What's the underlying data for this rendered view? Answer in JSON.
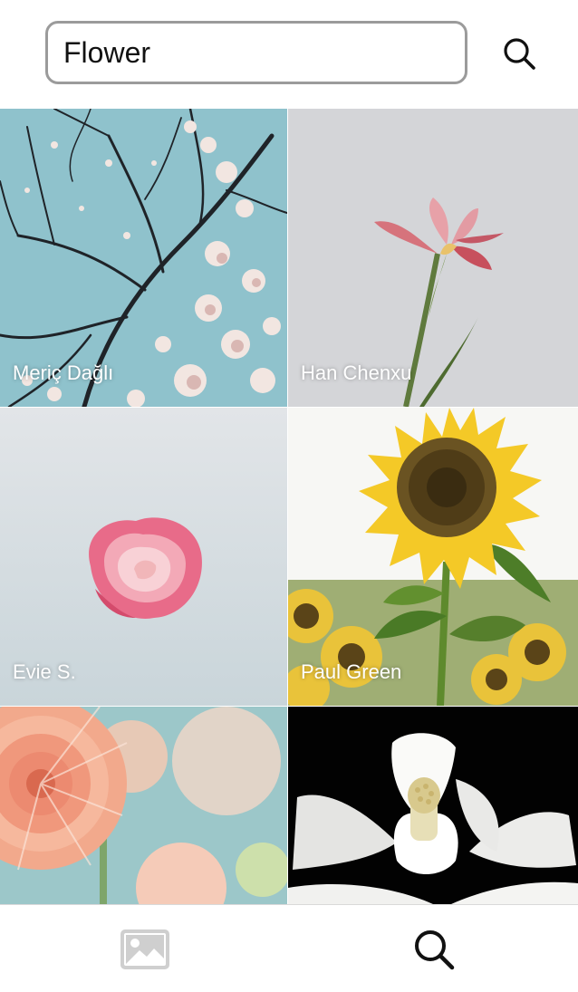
{
  "search": {
    "query": "Flower",
    "icon": "search-icon"
  },
  "photos": [
    {
      "credit": "Meriç Dağlı",
      "subject": "magnolia-tree"
    },
    {
      "credit": "Han Chenxu",
      "subject": "pink-iris"
    },
    {
      "credit": "Evie S.",
      "subject": "pink-rose"
    },
    {
      "credit": "Paul Green",
      "subject": "sunflower"
    },
    {
      "credit": "",
      "subject": "peach-dahlia"
    },
    {
      "credit": "",
      "subject": "white-magnolia"
    }
  ],
  "tabs": [
    {
      "icon": "photos-icon",
      "active": false
    },
    {
      "icon": "search-icon",
      "active": true
    }
  ]
}
